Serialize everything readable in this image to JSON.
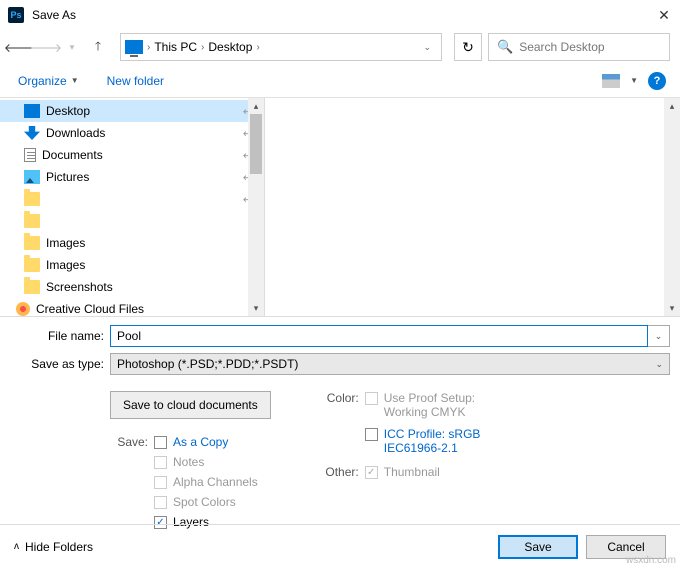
{
  "title": "Save As",
  "breadcrumb": {
    "root": "This PC",
    "folder": "Desktop"
  },
  "search": {
    "placeholder": "Search Desktop"
  },
  "toolbar": {
    "organize": "Organize",
    "newfolder": "New folder"
  },
  "tree": [
    {
      "label": "Desktop",
      "icon": "desktop",
      "pin": true,
      "sel": true
    },
    {
      "label": "Downloads",
      "icon": "down",
      "pin": true
    },
    {
      "label": "Documents",
      "icon": "docs",
      "pin": true
    },
    {
      "label": "Pictures",
      "icon": "pics",
      "pin": true
    },
    {
      "label": "",
      "icon": "folder",
      "pin": true
    },
    {
      "label": "",
      "icon": "folder"
    },
    {
      "label": "Images",
      "icon": "folder"
    },
    {
      "label": "Images",
      "icon": "folder"
    },
    {
      "label": "Screenshots",
      "icon": "folder"
    },
    {
      "label": "Creative Cloud Files",
      "icon": "cc",
      "indent": true
    }
  ],
  "form": {
    "filename_label": "File name:",
    "filename_value": "Pool",
    "type_label": "Save as type:",
    "type_value": "Photoshop (*.PSD;*.PDD;*.PSDT)"
  },
  "cloud_btn": "Save to cloud documents",
  "save_section": {
    "label": "Save:",
    "ascopy": "As a Copy",
    "notes": "Notes",
    "alpha": "Alpha Channels",
    "spot": "Spot Colors",
    "layers": "Layers"
  },
  "color_section": {
    "label": "Color:",
    "proof1": "Use Proof Setup:",
    "proof2": "Working CMYK",
    "icc1": "ICC Profile:  sRGB",
    "icc2": "IEC61966-2.1"
  },
  "other_section": {
    "label": "Other:",
    "thumb": "Thumbnail"
  },
  "footer": {
    "hide": "Hide Folders",
    "save": "Save",
    "cancel": "Cancel"
  },
  "watermark": "wsxdn.com"
}
